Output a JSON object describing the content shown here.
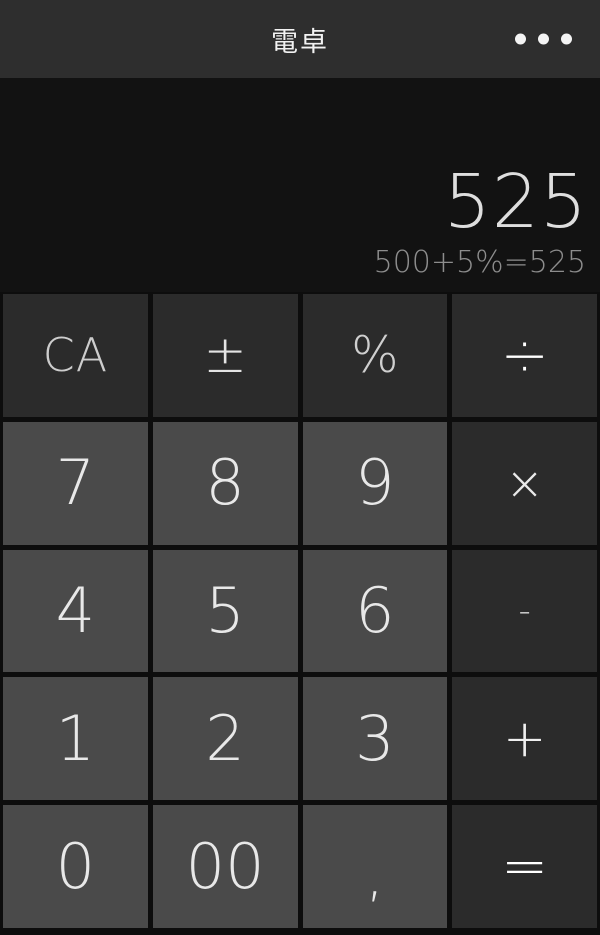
{
  "header": {
    "title": "電卓",
    "menu_icon": "more-horizontal-icon",
    "background": "#2e2e2e"
  },
  "display": {
    "result": "525",
    "expression": "500+5%=525",
    "background": "#121212",
    "result_color": "#dedede",
    "expression_color": "#8d8d8d"
  },
  "colors": {
    "number_key": "#4a4a4a",
    "operator_key": "#2b2b2b",
    "app_background": "#0d0d0d",
    "key_text": "#e8e8e8"
  },
  "keypad": {
    "rows": [
      [
        {
          "label": "CA",
          "name": "key-clear-all",
          "type": "fn",
          "mod": "k-ca"
        },
        {
          "label": "±",
          "name": "key-plus-minus",
          "type": "fn",
          "mod": "k-pm"
        },
        {
          "label": "%",
          "name": "key-percent",
          "type": "fn",
          "mod": "k-pct"
        },
        {
          "label": "÷",
          "name": "key-divide",
          "type": "op",
          "mod": "k-div"
        }
      ],
      [
        {
          "label": "7",
          "name": "key-7",
          "type": "num",
          "mod": ""
        },
        {
          "label": "8",
          "name": "key-8",
          "type": "num",
          "mod": ""
        },
        {
          "label": "9",
          "name": "key-9",
          "type": "num",
          "mod": ""
        },
        {
          "label": "×",
          "name": "key-multiply",
          "type": "op",
          "mod": "k-mul"
        }
      ],
      [
        {
          "label": "4",
          "name": "key-4",
          "type": "num",
          "mod": ""
        },
        {
          "label": "5",
          "name": "key-5",
          "type": "num",
          "mod": ""
        },
        {
          "label": "6",
          "name": "key-6",
          "type": "num",
          "mod": ""
        },
        {
          "label": "-",
          "name": "key-minus",
          "type": "op",
          "mod": "k-minus"
        }
      ],
      [
        {
          "label": "1",
          "name": "key-1",
          "type": "num",
          "mod": ""
        },
        {
          "label": "2",
          "name": "key-2",
          "type": "num",
          "mod": ""
        },
        {
          "label": "3",
          "name": "key-3",
          "type": "num",
          "mod": ""
        },
        {
          "label": "+",
          "name": "key-plus",
          "type": "op",
          "mod": "k-plus"
        }
      ],
      [
        {
          "label": "0",
          "name": "key-0",
          "type": "num",
          "mod": "k-zero"
        },
        {
          "label": "00",
          "name": "key-double-zero",
          "type": "num",
          "mod": "k-dzero"
        },
        {
          "label": ",",
          "name": "key-decimal-point",
          "type": "num",
          "mod": "k-dot"
        },
        {
          "label": "=",
          "name": "key-equals",
          "type": "op",
          "mod": "k-eq"
        }
      ]
    ]
  }
}
